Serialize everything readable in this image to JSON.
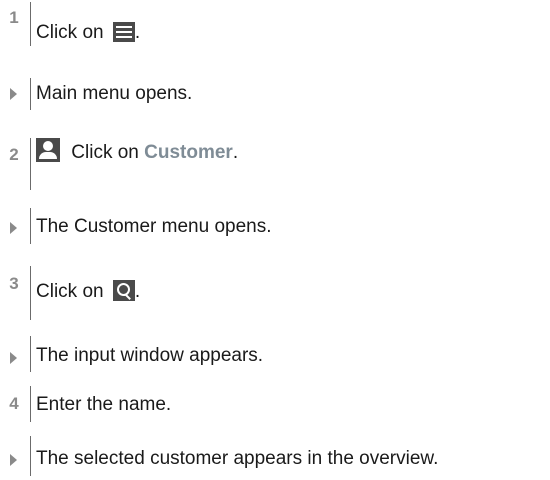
{
  "steps": [
    {
      "marker": "1",
      "before": "Click on ",
      "after": ".",
      "icon": "menu-icon"
    },
    {
      "marker": "arrow",
      "text": "Main menu opens."
    },
    {
      "marker": "2",
      "icon": "person-icon",
      "before": " Click on ",
      "highlight": "Customer",
      "after": "."
    },
    {
      "marker": "arrow",
      "text": "The Customer menu opens."
    },
    {
      "marker": "3",
      "before": "Click on ",
      "after": ".",
      "icon": "search-icon"
    },
    {
      "marker": "arrow",
      "text": "The input window appears."
    },
    {
      "marker": "4",
      "text": "Enter the name."
    },
    {
      "marker": "arrow",
      "text": "The selected customer appears in the overview."
    }
  ],
  "colors": {
    "text": "#1a1a1a",
    "marker": "#8a8a8a",
    "highlight": "#7f8c96",
    "icon": "#4a4a4a"
  }
}
